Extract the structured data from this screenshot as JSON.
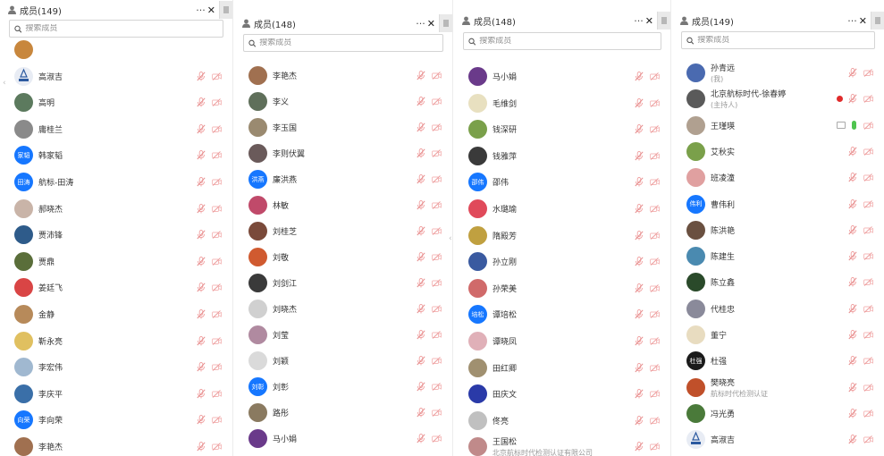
{
  "panels": [
    {
      "title": "成员(149)",
      "search_placeholder": "搜索成员",
      "members": [
        {
          "name": "",
          "avatar_color": "#c8873d",
          "partial": true
        },
        {
          "name": "高淑吉",
          "avatar_color": "#e8ecf4",
          "avatar_icon": "org-logo"
        },
        {
          "name": "高明",
          "avatar_color": "#5c7a5e"
        },
        {
          "name": "庸桂兰",
          "avatar_color": "#8a8a8a"
        },
        {
          "name": "韩家韬",
          "avatar_color": "#1677ff",
          "avatar_text": "家韬"
        },
        {
          "name": "航标-田涛",
          "avatar_color": "#1677ff",
          "avatar_text": "田涛"
        },
        {
          "name": "郝晓杰",
          "avatar_color": "#c9b4a8"
        },
        {
          "name": "贾沛锋",
          "avatar_color": "#2e5b8a"
        },
        {
          "name": "贾鼎",
          "avatar_color": "#5a6e3a"
        },
        {
          "name": "姜廷飞",
          "avatar_color": "#d94545"
        },
        {
          "name": "金静",
          "avatar_color": "#b78a5a"
        },
        {
          "name": "靳永亮",
          "avatar_color": "#e0c060"
        },
        {
          "name": "李宏伟",
          "avatar_color": "#a0b8d0"
        },
        {
          "name": "李庆平",
          "avatar_color": "#3a6fa8"
        },
        {
          "name": "李向荣",
          "avatar_color": "#1677ff",
          "avatar_text": "向荣"
        },
        {
          "name": "李艳杰",
          "avatar_color": "#a07050",
          "partial": true
        }
      ]
    },
    {
      "title": "成员(148)",
      "search_placeholder": "搜索成员",
      "members": [
        {
          "name": "李艳杰",
          "avatar_color": "#a07050"
        },
        {
          "name": "李义",
          "avatar_color": "#5f6f5a"
        },
        {
          "name": "李玉国",
          "avatar_color": "#9a8a70"
        },
        {
          "name": "李则伏翼",
          "avatar_color": "#6a5a5a"
        },
        {
          "name": "廉洪燕",
          "avatar_color": "#1677ff",
          "avatar_text": "洪燕"
        },
        {
          "name": "林敏",
          "avatar_color": "#c04a6a"
        },
        {
          "name": "刘桂芝",
          "avatar_color": "#7a4a3a"
        },
        {
          "name": "刘敬",
          "avatar_color": "#d05a30"
        },
        {
          "name": "刘剑江",
          "avatar_color": "#3a3a3a"
        },
        {
          "name": "刘晓杰",
          "avatar_color": "#d0d0d0"
        },
        {
          "name": "刘莹",
          "avatar_color": "#b08aa0"
        },
        {
          "name": "刘颖",
          "avatar_color": "#dadada"
        },
        {
          "name": "刘彰",
          "avatar_color": "#1677ff",
          "avatar_text": "刘彰"
        },
        {
          "name": "路彤",
          "avatar_color": "#8a7a60"
        },
        {
          "name": "马小娟",
          "avatar_color": "#6a3a8a"
        }
      ]
    },
    {
      "title": "成员(148)",
      "search_placeholder": "搜索成员",
      "members": [
        {
          "name": "马小娟",
          "avatar_color": "#6a3a8a"
        },
        {
          "name": "毛维剑",
          "avatar_color": "#e8e0c0"
        },
        {
          "name": "钱深研",
          "avatar_color": "#7aa04a"
        },
        {
          "name": "钱雅萍",
          "avatar_color": "#3a3a3a"
        },
        {
          "name": "邵伟",
          "avatar_color": "#1677ff",
          "avatar_text": "邵伟"
        },
        {
          "name": "水璐瑜",
          "avatar_color": "#e04a5a"
        },
        {
          "name": "隋殿芳",
          "avatar_color": "#c0a040"
        },
        {
          "name": "孙立刚",
          "avatar_color": "#3a5aa0"
        },
        {
          "name": "孙荣美",
          "avatar_color": "#d06a6a"
        },
        {
          "name": "谭培松",
          "avatar_color": "#1677ff",
          "avatar_text": "培松"
        },
        {
          "name": "谭晓凤",
          "avatar_color": "#e0b0b8"
        },
        {
          "name": "田红卿",
          "avatar_color": "#a09070"
        },
        {
          "name": "田庆文",
          "avatar_color": "#2a3aa8"
        },
        {
          "name": "佟亮",
          "avatar_color": "#c0c0c0"
        },
        {
          "name": "王国松",
          "sub": "北京航标时代检测认证有限公司",
          "avatar_color": "#c08a8a",
          "partial": true
        }
      ]
    },
    {
      "title": "成员(149)",
      "search_placeholder": "搜索成员",
      "members": [
        {
          "name": "孙青远",
          "sub": "(我)",
          "avatar_color": "#4a6ab0"
        },
        {
          "name": "北京航标时代-徐春婷",
          "sub": "(主持人)",
          "avatar_color": "#5a5a5a",
          "recording": true
        },
        {
          "name": "王瑾瑛",
          "avatar_color": "#b0a090",
          "speaking": true
        },
        {
          "name": "艾秋实",
          "avatar_color": "#7aa04a"
        },
        {
          "name": "班凌潼",
          "avatar_color": "#e0a0a0"
        },
        {
          "name": "曹伟利",
          "avatar_color": "#1677ff",
          "avatar_text": "伟利"
        },
        {
          "name": "陈洪艳",
          "avatar_color": "#6a5040"
        },
        {
          "name": "陈建生",
          "avatar_color": "#4a8ab0"
        },
        {
          "name": "陈立鑫",
          "avatar_color": "#2a4a2a"
        },
        {
          "name": "代桂忠",
          "avatar_color": "#8a8a9a"
        },
        {
          "name": "董宁",
          "avatar_color": "#e8dcc0"
        },
        {
          "name": "杜强",
          "avatar_color": "#1a1a1a",
          "avatar_text": "杜强"
        },
        {
          "name": "樊晓亮",
          "sub": "航标时代检测认证",
          "avatar_color": "#c0502a"
        },
        {
          "name": "冯光勇",
          "avatar_color": "#4a7a3a"
        },
        {
          "name": "高淑吉",
          "avatar_color": "#e8ecf4",
          "avatar_icon": "org-logo"
        }
      ]
    }
  ]
}
